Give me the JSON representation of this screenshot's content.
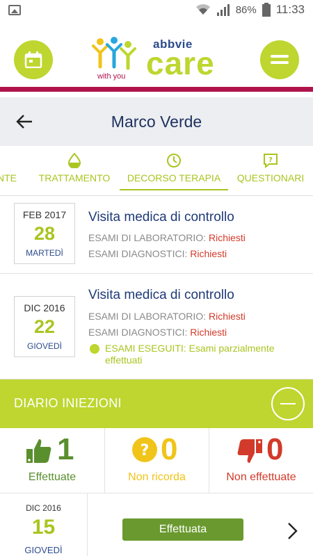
{
  "status_bar": {
    "battery": "86%",
    "time": "11:33"
  },
  "header": {
    "logo_brand": "abbvie",
    "logo_product": "care",
    "logo_tagline": "with you",
    "colors": {
      "accent": "#bed62f",
      "brand_bar": "#b0134b",
      "navy": "#1f3260"
    }
  },
  "title": {
    "name": "Marco Verde"
  },
  "tabs": [
    {
      "label": "NTE",
      "icon": "none"
    },
    {
      "label": "TRATTAMENTO",
      "icon": "drop-icon"
    },
    {
      "label": "DECORSO TERAPIA",
      "icon": "clock-icon",
      "active": true
    },
    {
      "label": "QUESTIONARI",
      "icon": "question-bubble-icon"
    }
  ],
  "visits": [
    {
      "month": "FEB 2017",
      "day": "28",
      "weekday": "MARTEDÌ",
      "title": "Visita medica di controllo",
      "lab_label": "ESAMI DI LABORATORIO:",
      "lab_value": "Richiesti",
      "diag_label": "ESAMI DIAGNOSTICI:",
      "diag_value": "Richiesti"
    },
    {
      "month": "DIC 2016",
      "day": "22",
      "weekday": "GIOVEDÌ",
      "title": "Visita medica di controllo",
      "lab_label": "ESAMI DI LABORATORIO:",
      "lab_value": "Richiesti",
      "diag_label": "ESAMI DIAGNOSTICI:",
      "diag_value": "Richiesti",
      "done_text": "ESAMI ESEGUITI: Esami parzialmente effettuati"
    }
  ],
  "diary": {
    "title": "DIARIO INIEZIONI",
    "stats": [
      {
        "value": "1",
        "label": "Effettuate",
        "icon": "thumbs-up-icon"
      },
      {
        "value": "0",
        "label": "Non ricorda",
        "icon": "question-circle-icon"
      },
      {
        "value": "0",
        "label": "Non effettuate",
        "icon": "thumbs-down-icon"
      }
    ],
    "entries": [
      {
        "month": "DIC 2016",
        "day": "15",
        "weekday": "GIOVEDÌ",
        "status": "Effettuata"
      }
    ]
  }
}
